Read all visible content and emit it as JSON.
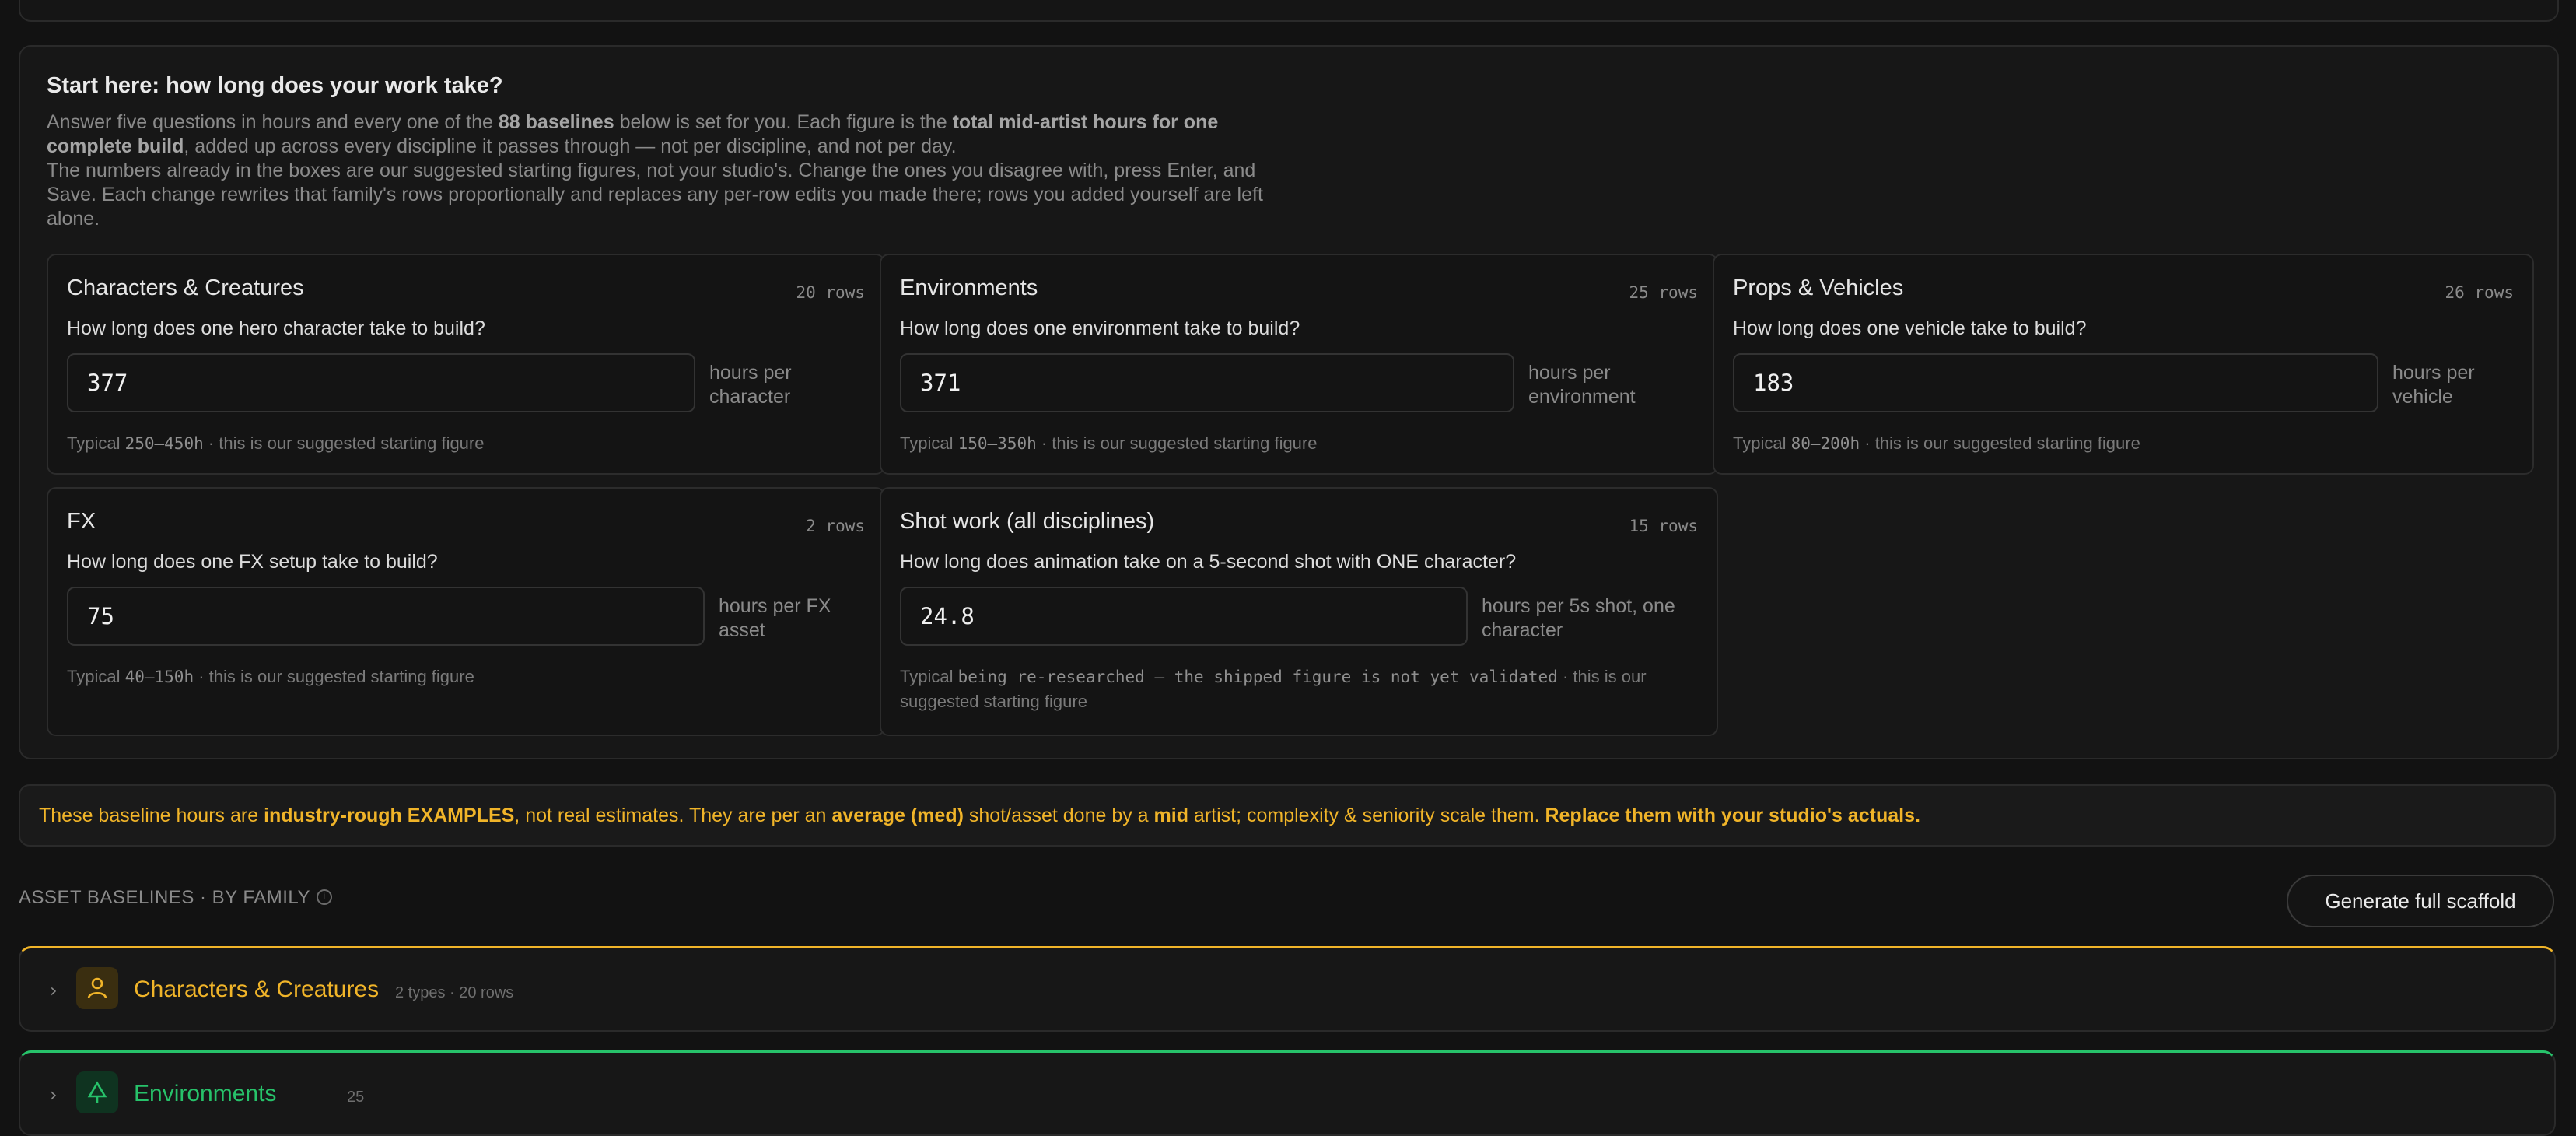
{
  "intro": {
    "title": "Start here: how long does your work take?",
    "desc_1": "Answer five questions in hours and every one of the ",
    "desc_bold_1": "88 baselines",
    "desc_2": " below is set for you. Each figure is the ",
    "desc_bold_2": "total mid-artist hours for one complete build",
    "desc_3": ", added up across every discipline it passes through — not per discipline, and not per day.",
    "desc_4": "The numbers already in the boxes are our suggested starting figures, not your studio's. Change the ones you disagree with, press Enter, and Save. Each change rewrites that family's rows proportionally and replaces any per-row edits you made there; rows you added yourself are left alone."
  },
  "families": [
    {
      "title": "Characters & Creatures",
      "rows": "20 rows",
      "question": "How long does one hero character take to build?",
      "value": "377",
      "unit": "hours per character",
      "typ_prefix": "Typical ",
      "typ_range": "250–450h",
      "typ_suffix": " · this is our suggested starting figure"
    },
    {
      "title": "Environments",
      "rows": "25 rows",
      "question": "How long does one environment take to build?",
      "value": "371",
      "unit": "hours per environment",
      "typ_prefix": "Typical ",
      "typ_range": "150–350h",
      "typ_suffix": " · this is our suggested starting figure"
    },
    {
      "title": "Props & Vehicles",
      "rows": "26 rows",
      "question": "How long does one vehicle take to build?",
      "value": "183",
      "unit": "hours per vehicle",
      "typ_prefix": "Typical ",
      "typ_range": "80–200h",
      "typ_suffix": " · this is our suggested starting figure"
    },
    {
      "title": "FX",
      "rows": "2 rows",
      "question": "How long does one FX setup take to build?",
      "value": "75",
      "unit": "hours per FX asset",
      "typ_prefix": "Typical ",
      "typ_range": "40–150h",
      "typ_suffix": " · this is our suggested starting figure"
    },
    {
      "title": "Shot work (all disciplines)",
      "rows": "15 rows",
      "question": "How long does animation take on a 5-second shot with ONE character?",
      "value": "24.8",
      "unit": "hours per 5s shot, one character",
      "typ_prefix": "Typical ",
      "typ_range": "being re-researched — the shipped figure is not yet validated",
      "typ_suffix": " · this is our suggested starting figure"
    }
  ],
  "banner": {
    "t1": "These baseline hours are ",
    "b1": "industry-rough EXAMPLES",
    "t2": ", not real estimates. They are per an ",
    "b2": "average (med)",
    "t3": " shot/asset done by a ",
    "b3": "mid",
    "t4": " artist; complexity & seniority scale them. ",
    "b4": "Replace them with your studio's actuals."
  },
  "section": {
    "label": "ASSET BASELINES · BY FAMILY",
    "generate_label": "Generate full scaffold"
  },
  "accordion": [
    {
      "title": "Characters & Creatures",
      "meta": "2 types · 20 rows",
      "icon": "person-icon",
      "color": "#f0b429"
    },
    {
      "title": "Environments",
      "meta": "25",
      "icon": "tree-icon",
      "color": "#27c26a"
    }
  ]
}
